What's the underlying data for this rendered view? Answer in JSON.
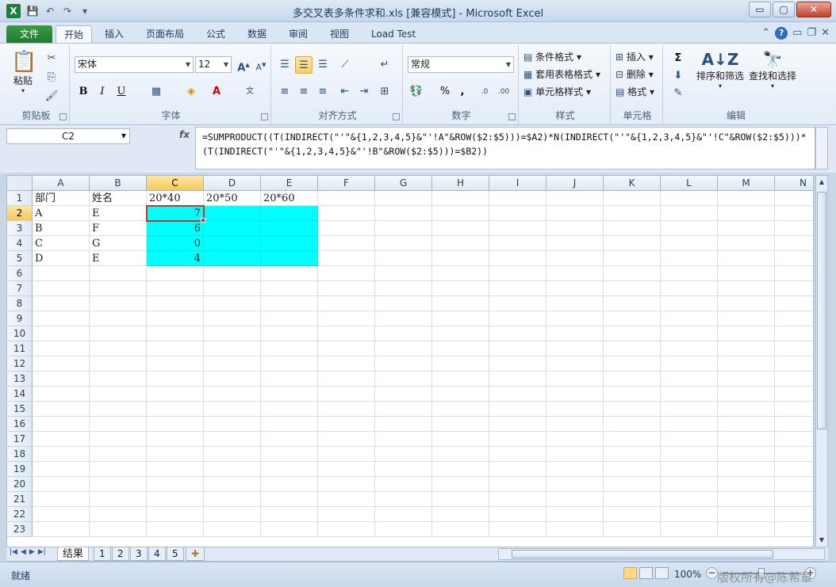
{
  "window": {
    "title": "多交叉表多条件求和.xls  [兼容模式] - Microsoft Excel",
    "min_glyph": "▭",
    "max_glyph": "▢",
    "close_glyph": "✕"
  },
  "qat": {
    "save_glyph": "💾",
    "undo_glyph": "↶",
    "redo_glyph": "↷",
    "customize_glyph": "▾"
  },
  "tabs": [
    {
      "label": "文件"
    },
    {
      "label": "开始"
    },
    {
      "label": "插入"
    },
    {
      "label": "页面布局"
    },
    {
      "label": "公式"
    },
    {
      "label": "数据"
    },
    {
      "label": "审阅"
    },
    {
      "label": "视图"
    },
    {
      "label": "Load Test"
    }
  ],
  "ribbon": {
    "clipboard": {
      "paste": "粘贴",
      "label": "剪贴板"
    },
    "font": {
      "name": "宋体",
      "size": "12",
      "label": "字体",
      "bold": "B",
      "italic": "I",
      "underline": "U"
    },
    "alignment": {
      "label": "对齐方式"
    },
    "number": {
      "format": "常规",
      "label": "数字",
      "percent": "%",
      "comma": ","
    },
    "styles": {
      "conditional": "条件格式",
      "table": "套用表格格式",
      "cell": "单元格样式",
      "label": "样式"
    },
    "cells": {
      "insert": "插入",
      "delete": "删除",
      "format": "格式",
      "label": "单元格"
    },
    "editing": {
      "sort": "排序和筛选",
      "find": "查找和选择",
      "label": "编辑",
      "sigma": "Σ"
    }
  },
  "formula_bar": {
    "name_box": "C2",
    "fx": "fx",
    "formula": "=SUMPRODUCT((T(INDIRECT(\"'\"&{1,2,3,4,5}&\"'!A\"&ROW($2:$5)))=$A2)*N(INDIRECT(\"'\"&{1,2,3,4,5}&\"'!C\"&ROW($2:$5)))*(T(INDIRECT(\"'\"&{1,2,3,4,5}&\"'!B\"&ROW($2:$5)))=$B2))"
  },
  "columns": [
    "A",
    "B",
    "C",
    "D",
    "E",
    "F",
    "G",
    "H",
    "I",
    "J",
    "K",
    "L",
    "M",
    "N"
  ],
  "rows": [
    "1",
    "2",
    "3",
    "4",
    "5",
    "6",
    "7",
    "8",
    "9",
    "10",
    "11",
    "12",
    "13",
    "14",
    "15",
    "16",
    "17",
    "18",
    "19",
    "20",
    "21",
    "22",
    "23"
  ],
  "cells": {
    "A1": "部门",
    "B1": "姓名",
    "C1": "20*40",
    "D1": "20*50",
    "E1": "20*60",
    "A2": "A",
    "B2": "E",
    "C2": "7",
    "A3": "B",
    "B3": "F",
    "C3": "6",
    "A4": "C",
    "B4": "G",
    "C4": "0",
    "A5": "D",
    "B5": "E",
    "C5": "4"
  },
  "sheets": [
    {
      "label": "结果"
    },
    {
      "label": "1"
    },
    {
      "label": "2"
    },
    {
      "label": "3"
    },
    {
      "label": "4"
    },
    {
      "label": "5"
    }
  ],
  "status": {
    "ready": "就绪",
    "zoom": "100%"
  },
  "watermark": "版权所有@陈希章",
  "colors": {
    "selection_fill": "#00ffff",
    "active_border": "#c0392b"
  }
}
